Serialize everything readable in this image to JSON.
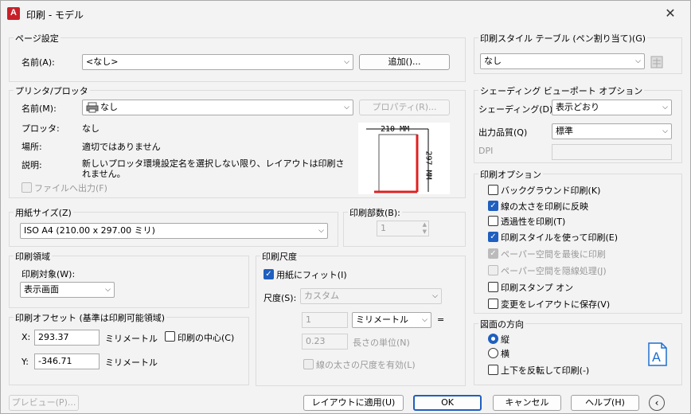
{
  "window": {
    "title": "印刷 - モデル",
    "app_icon": "A"
  },
  "page_setup": {
    "title": "ページ設定",
    "name_label": "名前(A):",
    "name_value": "<なし>",
    "add_button": "追加()..."
  },
  "printer": {
    "title": "プリンタ/プロッタ",
    "name_label": "名前(M):",
    "name_value": "なし",
    "properties_button": "プロパティ(R)...",
    "plotter_label": "プロッタ:",
    "plotter_value": "なし",
    "location_label": "場所:",
    "location_value": "適切ではありません",
    "description_label": "説明:",
    "description_value": "新しいプロッタ環境設定名を選択しない限り、レイアウトは印刷されません。",
    "print_to_file": "ファイルへ出力(F)",
    "preview_width": "210 MM",
    "preview_height": "297 MM"
  },
  "paper_size": {
    "title": "用紙サイズ(Z)",
    "value": "ISO A4 (210.00 x 297.00 ミリ)"
  },
  "copies": {
    "title": "印刷部数(B):",
    "value": "1"
  },
  "plot_area": {
    "title": "印刷領域",
    "what_label": "印刷対象(W):",
    "what_value": "表示画面"
  },
  "plot_offset": {
    "title": "印刷オフセット (基準は印刷可能領域)",
    "x_label": "X:",
    "x_value": "293.37",
    "x_unit": "ミリメートル",
    "y_label": "Y:",
    "y_value": "-346.71",
    "y_unit": "ミリメートル",
    "center_label": "印刷の中心(C)"
  },
  "plot_scale": {
    "title": "印刷尺度",
    "fit_label": "用紙にフィット(I)",
    "scale_label": "尺度(S):",
    "scale_value": "カスタム",
    "val1": "1",
    "unit_value": "ミリメートル",
    "eq": "=",
    "val2": "0.23",
    "unit_label": "長さの単位(N)",
    "lineweight_label": "線の太さの尺度を有効(L)"
  },
  "style_table": {
    "title": "印刷スタイル テーブル (ペン割り当て)(G)",
    "value": "なし"
  },
  "shaded": {
    "title": "シェーディング ビューポート オプション",
    "shade_label": "シェーディング(D)",
    "shade_value": "表示どおり",
    "quality_label": "出力品質(Q)",
    "quality_value": "標準",
    "dpi_label": "DPI"
  },
  "plot_options": {
    "title": "印刷オプション",
    "items": [
      "バックグラウンド印刷(K)",
      "線の太さを印刷に反映",
      "透過性を印刷(T)",
      "印刷スタイルを使って印刷(E)",
      "ペーパー空間を最後に印刷",
      "ペーパー空間を隠線処理(J)",
      "印刷スタンプ オン",
      "変更をレイアウトに保存(V)"
    ]
  },
  "orientation": {
    "title": "図面の方向",
    "portrait": "縦",
    "landscape": "横",
    "upside_down": "上下を反転して印刷(-)"
  },
  "footer": {
    "preview": "プレビュー(P)...",
    "apply": "レイアウトに適用(U)",
    "ok": "OK",
    "cancel": "キャンセル",
    "help": "ヘルプ(H)"
  }
}
